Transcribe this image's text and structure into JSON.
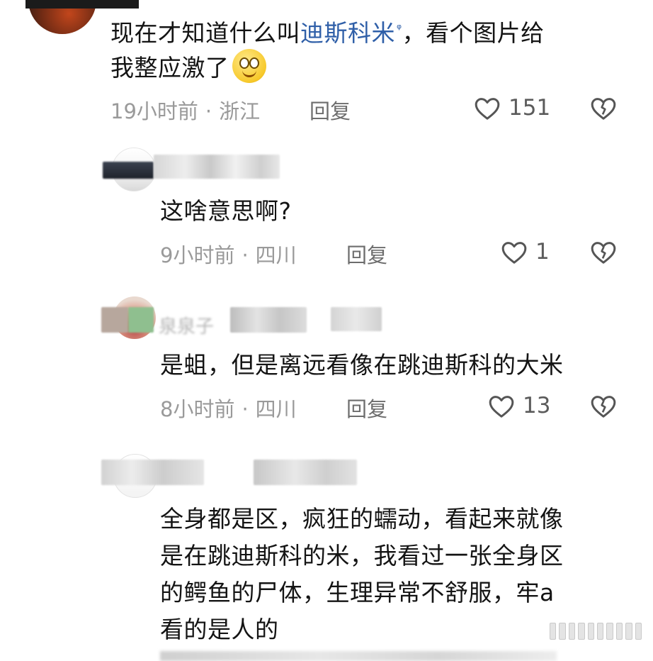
{
  "comments": [
    {
      "text_line1_prefix": "现在才知道什么叫",
      "text_line1_link": "迪斯科米",
      "text_line1_search": "ᵠ",
      "text_line1_suffix": "，看个图片给",
      "text_line2": "我整应激了",
      "time": "19小时前",
      "location": "浙江",
      "reply": "回复",
      "likes": "151"
    },
    {
      "text": "这啥意思啊?",
      "time": "9小时前",
      "location": "四川",
      "reply": "回复",
      "likes": "1"
    },
    {
      "user_fragment": "泉泉子",
      "text": "是蛆，但是离远看像在跳迪斯科的大米",
      "time": "8小时前",
      "location": "四川",
      "reply": "回复",
      "likes": "13"
    },
    {
      "lines": [
        "全身都是区，疯狂的蠕动，看起来就像",
        "是在跳迪斯科的米，我看过一张全身区",
        "的鳄鱼的尸体，生理异常不舒服，牢a",
        "看的是人的"
      ]
    }
  ],
  "separator": "·",
  "icons": {
    "like": "heart-outline-icon",
    "dislike": "broken-heart-icon",
    "emoji": "smile-emoji-icon",
    "search": "search-mark-icon"
  },
  "colors": {
    "link": "#2f5fa8",
    "meta": "#9a9a9a",
    "text": "#141414"
  }
}
